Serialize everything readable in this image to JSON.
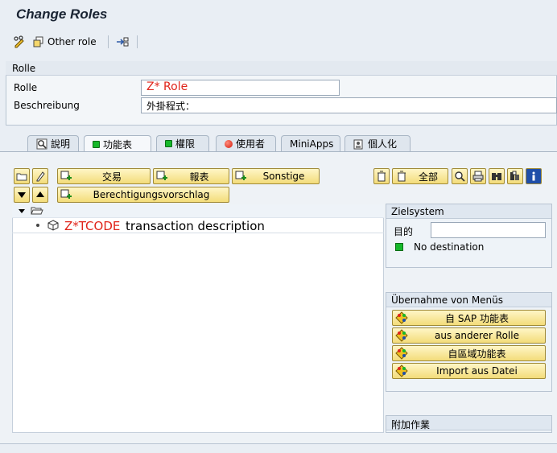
{
  "title": "Change Roles",
  "toolbar": {
    "other_role": "Other role"
  },
  "rolle_group": {
    "header": "Rolle",
    "role_label": "Rolle",
    "role_value": "Z* Role",
    "desc_label": "Beschreibung",
    "desc_value": "外掛程式："
  },
  "tabs": [
    {
      "label": "說明",
      "icon": "magnifier-icon"
    },
    {
      "label": "功能表",
      "icon": "green-status-icon",
      "active": true
    },
    {
      "label": "權限",
      "icon": "green-status-icon"
    },
    {
      "label": "使用者",
      "icon": "red-status-icon"
    },
    {
      "label": "MiniApps"
    },
    {
      "label": "個人化",
      "icon": "personalize-icon"
    }
  ],
  "buttons": {
    "transaction": "交易",
    "report": "報表",
    "other": "Sonstige",
    "all": "全部",
    "auth_proposal": "Berechtigungsvorschlag"
  },
  "tree": {
    "code": "Z*TCODE",
    "description": "transaction description"
  },
  "zielsystem": {
    "header": "Zielsystem",
    "target_label": "目的",
    "target_value": "",
    "status": "No destination"
  },
  "uebernahme": {
    "header": "Übernahme von Menüs",
    "items": [
      "自 SAP 功能表",
      "aus anderer Rolle",
      "自區域功能表",
      "Import aus Datei"
    ]
  },
  "extra": {
    "header": "附加作業"
  },
  "colors": {
    "accent_red": "#e0251b",
    "status_green": "#16b82a"
  }
}
